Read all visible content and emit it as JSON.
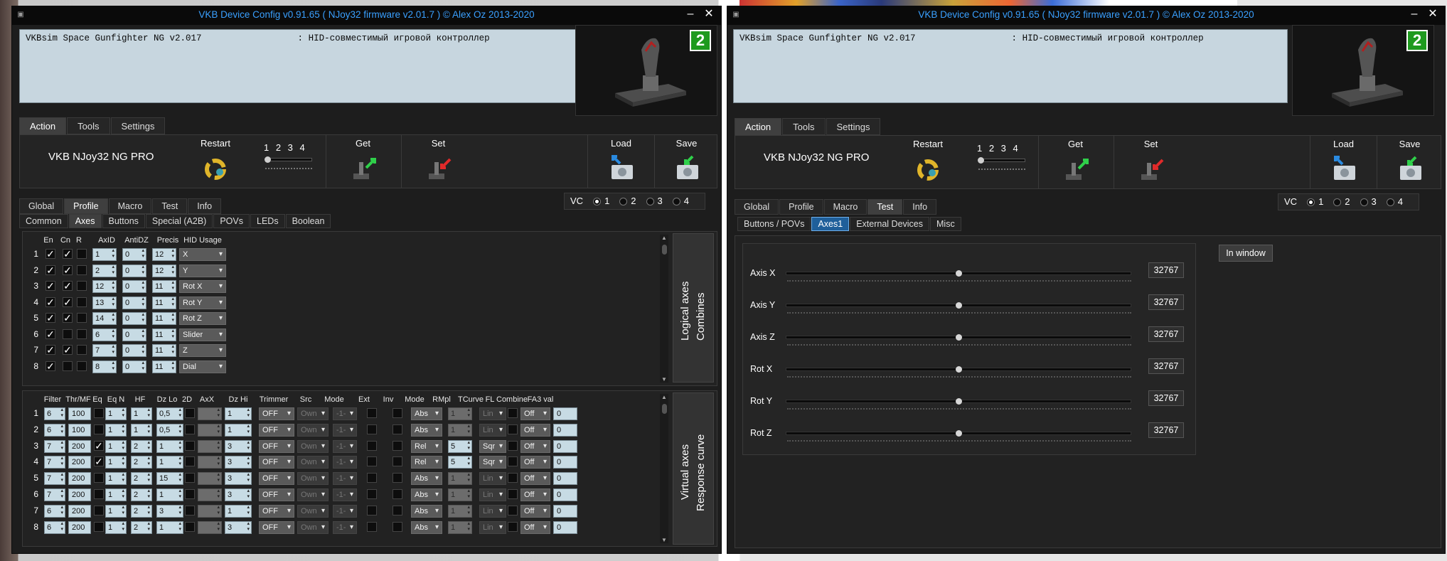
{
  "window_title": "VKB Device Config v0.91.65 ( NJoy32 firmware v2.01.7 ) © Alex Oz 2013-2020",
  "device_info": "VKBsim Space Gunfighter NG v2.017                  : HID-совместимый игровой контроллер",
  "badge": "2",
  "main_tabs": [
    "Action",
    "Tools",
    "Settings"
  ],
  "toolbar": {
    "device_name": "VKB NJoy32 NG PRO",
    "restart": "Restart",
    "pages": "1 2 3 4",
    "get": "Get",
    "set": "Set",
    "load": "Load",
    "save": "Save"
  },
  "vc": {
    "label": "VC",
    "options": [
      "1",
      "2",
      "3",
      "4"
    ]
  },
  "section_tabs": [
    "Global",
    "Profile",
    "Macro",
    "Test",
    "Info"
  ],
  "profile_subtabs": [
    "Common",
    "Axes",
    "Buttons",
    "Special (A2B)",
    "POVs",
    "LEDs",
    "Boolean"
  ],
  "logical": {
    "headers": [
      "En",
      "Cn",
      "R",
      "AxID",
      "AntiDZ",
      "Precis",
      "HID Usage"
    ],
    "side_label_1": "Logical axes",
    "side_label_2": "Combines",
    "rows": [
      {
        "n": "1",
        "en": "✓",
        "cn": "✓",
        "axid": "1",
        "antidz": "0",
        "precis": "12",
        "usage": "X"
      },
      {
        "n": "2",
        "en": "✓",
        "cn": "✓",
        "axid": "2",
        "antidz": "0",
        "precis": "12",
        "usage": "Y"
      },
      {
        "n": "3",
        "en": "✓",
        "cn": "✓",
        "axid": "12",
        "antidz": "0",
        "precis": "11",
        "usage": "Rot X"
      },
      {
        "n": "4",
        "en": "✓",
        "cn": "✓",
        "axid": "13",
        "antidz": "0",
        "precis": "11",
        "usage": "Rot Y"
      },
      {
        "n": "5",
        "en": "✓",
        "cn": "✓",
        "axid": "14",
        "antidz": "0",
        "precis": "11",
        "usage": "Rot Z"
      },
      {
        "n": "6",
        "en": "✓",
        "cn": "",
        "axid": "6",
        "antidz": "0",
        "precis": "11",
        "usage": "Slider"
      },
      {
        "n": "7",
        "en": "✓",
        "cn": "✓",
        "axid": "7",
        "antidz": "0",
        "precis": "11",
        "usage": "Z"
      },
      {
        "n": "8",
        "en": "✓",
        "cn": "",
        "axid": "8",
        "antidz": "0",
        "precis": "11",
        "usage": "Dial"
      }
    ]
  },
  "virtual": {
    "headers": [
      "Filter",
      "Thr/MF",
      "Eq",
      "Eq N",
      "HF",
      "Dz Lo",
      "2D",
      "AxX",
      "Dz Hi",
      "Trimmer",
      "Src",
      "Mode",
      "Ext",
      "Inv",
      "Mode",
      "RMpl",
      "TCurve",
      "FL",
      "Combine",
      "FA3 val"
    ],
    "side_label_1": "Virtual axes",
    "side_label_2": "Response curve",
    "rows": [
      {
        "n": "1",
        "filter": "6",
        "thr": "100",
        "eq": "",
        "eqn": "1",
        "hf": "1",
        "dzlo": "0,5",
        "dzhi": "1",
        "trim": "OFF",
        "src": "Own",
        "mode": "-1-",
        "mode2": "Abs",
        "rmpl": "1",
        "tcurve": "Lin",
        "combine": "Off",
        "fa3": "0"
      },
      {
        "n": "2",
        "filter": "6",
        "thr": "100",
        "eq": "",
        "eqn": "1",
        "hf": "1",
        "dzlo": "0,5",
        "dzhi": "1",
        "trim": "OFF",
        "src": "Own",
        "mode": "-1-",
        "mode2": "Abs",
        "rmpl": "1",
        "tcurve": "Lin",
        "combine": "Off",
        "fa3": "0"
      },
      {
        "n": "3",
        "filter": "7",
        "thr": "200",
        "eq": "✓",
        "eqn": "1",
        "hf": "2",
        "dzlo": "1",
        "dzhi": "3",
        "trim": "OFF",
        "src": "Own",
        "mode": "-1-",
        "mode2": "Rel",
        "rmpl": "5",
        "tcurve": "Sqr",
        "combine": "Off",
        "fa3": "0"
      },
      {
        "n": "4",
        "filter": "7",
        "thr": "200",
        "eq": "✓",
        "eqn": "1",
        "hf": "2",
        "dzlo": "1",
        "dzhi": "3",
        "trim": "OFF",
        "src": "Own",
        "mode": "-1-",
        "mode2": "Rel",
        "rmpl": "5",
        "tcurve": "Sqr",
        "combine": "Off",
        "fa3": "0"
      },
      {
        "n": "5",
        "filter": "7",
        "thr": "200",
        "eq": "",
        "eqn": "1",
        "hf": "2",
        "dzlo": "15",
        "dzhi": "3",
        "trim": "OFF",
        "src": "Own",
        "mode": "-1-",
        "mode2": "Abs",
        "rmpl": "1",
        "tcurve": "Lin",
        "combine": "Off",
        "fa3": "0"
      },
      {
        "n": "6",
        "filter": "7",
        "thr": "200",
        "eq": "",
        "eqn": "1",
        "hf": "2",
        "dzlo": "1",
        "dzhi": "3",
        "trim": "OFF",
        "src": "Own",
        "mode": "-1-",
        "mode2": "Abs",
        "rmpl": "1",
        "tcurve": "Lin",
        "combine": "Off",
        "fa3": "0"
      },
      {
        "n": "7",
        "filter": "6",
        "thr": "200",
        "eq": "",
        "eqn": "1",
        "hf": "2",
        "dzlo": "3",
        "dzhi": "1",
        "trim": "OFF",
        "src": "Own",
        "mode": "-1-",
        "mode2": "Abs",
        "rmpl": "1",
        "tcurve": "Lin",
        "combine": "Off",
        "fa3": "0"
      },
      {
        "n": "8",
        "filter": "6",
        "thr": "200",
        "eq": "",
        "eqn": "1",
        "hf": "2",
        "dzlo": "1",
        "dzhi": "3",
        "trim": "OFF",
        "src": "Own",
        "mode": "-1-",
        "mode2": "Abs",
        "rmpl": "1",
        "tcurve": "Lin",
        "combine": "Off",
        "fa3": "0"
      }
    ]
  },
  "test_subtabs": [
    "Buttons / POVs",
    "Axes1",
    "External Devices",
    "Misc"
  ],
  "test": {
    "in_window": "In window",
    "axes": [
      {
        "name": "Axis X",
        "value": "32767",
        "level": 0.5
      },
      {
        "name": "Axis Y",
        "value": "32767",
        "level": 0.5
      },
      {
        "name": "Axis Z",
        "value": "32767",
        "level": 0.5
      },
      {
        "name": "Rot X",
        "value": "32767",
        "level": 0.5
      },
      {
        "name": "Rot Y",
        "value": "32767",
        "level": 0.5
      },
      {
        "name": "Rot Z",
        "value": "32767",
        "level": 0.5
      }
    ]
  },
  "colors": {
    "title_text": "#3aa0ff",
    "badge": "#1e9a1e",
    "field_bg": "#c7dbe4",
    "selected_tab": "#1f5f9a"
  }
}
